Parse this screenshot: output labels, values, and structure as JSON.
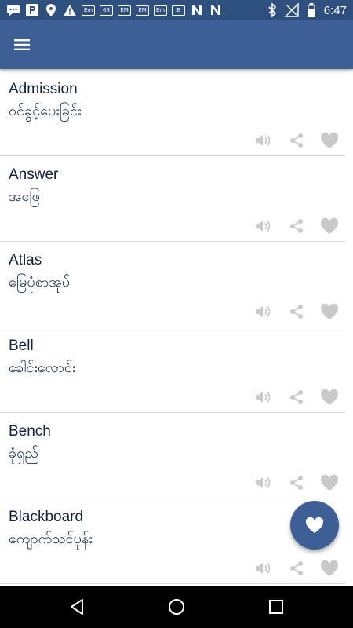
{
  "status_bar": {
    "time": "6:47",
    "notification_icons": [
      "chat-bubble-icon",
      "parking-icon",
      "location-pin-icon",
      "warning-icon"
    ],
    "small_badges": [
      "Em",
      "68",
      "EM",
      "EM",
      "Em",
      "E"
    ]
  },
  "app_bar": {
    "menu_icon": "hamburger-menu-icon"
  },
  "entries": [
    {
      "word": "Admission",
      "translation": "ဝင်ခွင့်ပေးခြင်း"
    },
    {
      "word": "Answer",
      "translation": "အဖြေ"
    },
    {
      "word": "Atlas",
      "translation": "မြေပုံစာအုပ်"
    },
    {
      "word": "Bell",
      "translation": "ခေါင်းလောင်း"
    },
    {
      "word": "Bench",
      "translation": "ခုံရှည်"
    },
    {
      "word": "Blackboard",
      "translation": "ကျောက်သင်ပုန်း"
    }
  ],
  "colors": {
    "app_bar": "#3d5f96",
    "status_bar": "#2f4f7f",
    "action_icon": "#c9c9c9",
    "word_text": "#111f37"
  },
  "fab": {
    "icon": "heart-icon"
  },
  "nav_bar": {
    "icons": [
      "back-icon",
      "home-icon",
      "recents-icon"
    ]
  }
}
